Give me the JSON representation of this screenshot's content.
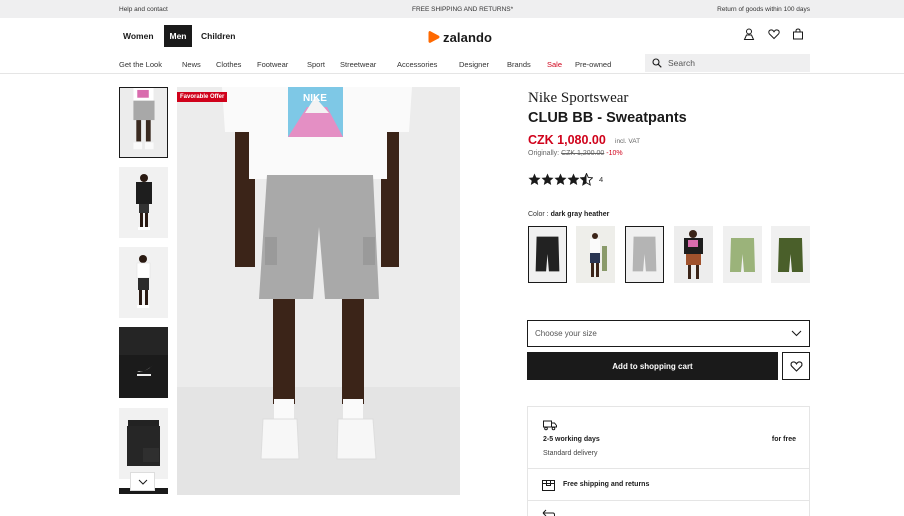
{
  "topbar": {
    "help": "Help and contact",
    "shipping": "FREE SHIPPING AND RETURNS*",
    "returns": "Return of goods within 100 days"
  },
  "header": {
    "genders": [
      "Women",
      "Men",
      "Children"
    ],
    "logo": "zalando",
    "icons": [
      "user-icon",
      "heart-icon",
      "bag-icon"
    ]
  },
  "nav": {
    "items": [
      "Get the Look",
      "News",
      "Clothes",
      "Footwear",
      "Sport",
      "Streetwear",
      "Accessories",
      "Designer",
      "Brands",
      "Sale",
      "Pre-owned"
    ]
  },
  "search": {
    "placeholder": "Search"
  },
  "product": {
    "badge": "Favorable Offer",
    "brand": "Nike Sportswear",
    "name": "CLUB BB - Sweatpants",
    "price": "CZK 1,080.00",
    "vat": "incl. VAT",
    "original_prefix": "Originally:",
    "original_price": "CZK 1,200.00",
    "discount": "-10%",
    "rating": 4.5,
    "review_count": "4",
    "color_label": "Color :",
    "color_value": "dark gray heather",
    "size_placeholder": "Choose your size",
    "add_to_cart": "Add to shopping cart"
  },
  "delivery": {
    "days": "2-5 working days",
    "price": "for free",
    "method": "Standard delivery",
    "shipping": "Free shipping and returns"
  },
  "colors": {
    "brand_orange": "#ff6900",
    "sale_red": "#d0021b",
    "black": "#1a1a1a"
  }
}
